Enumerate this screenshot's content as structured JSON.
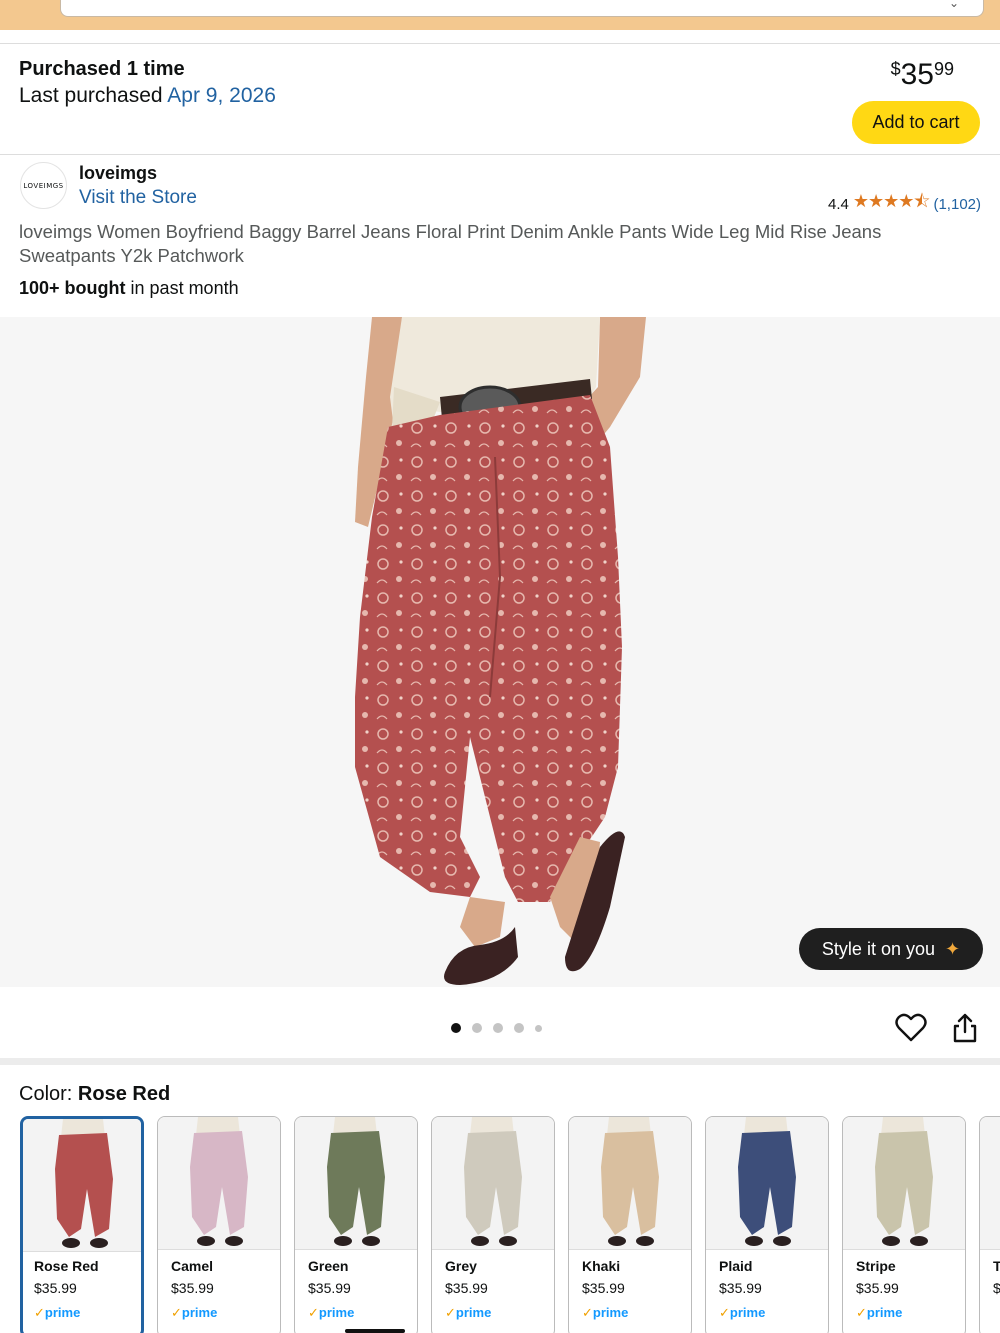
{
  "purchase": {
    "title": "Purchased 1 time",
    "last_prefix": "Last purchased",
    "last_date": "Apr 9, 2026",
    "price_currency": "$",
    "price_dollars": "35",
    "price_cents": "99",
    "add_to_cart_label": "Add to cart"
  },
  "store": {
    "logo_text": "LOVEIMGS",
    "name": "loveimgs",
    "visit_label": "Visit the Store",
    "rating_value": "4.4",
    "rating_stars": 4.4,
    "rating_count": "(1,102)"
  },
  "product": {
    "title": "loveimgs Women Boyfriend Baggy Barrel Jeans Floral Print Denim Ankle Pants Wide Leg Mid Rise Jeans Sweatpants Y2k Patchwork",
    "bought_bold": "100+ bought",
    "bought_rest": "in past month"
  },
  "gallery": {
    "style_button_label": "Style it on you",
    "dots_total": 5,
    "active_dot": 0
  },
  "color": {
    "label": "Color:",
    "selected": "Rose Red",
    "options": [
      {
        "name": "Rose Red",
        "price": "$35.99",
        "prime": "prime",
        "color": "#b4504f"
      },
      {
        "name": "Camel",
        "price": "$35.99",
        "prime": "prime",
        "color": "#d7b7c6"
      },
      {
        "name": "Green",
        "price": "$35.99",
        "prime": "prime",
        "color": "#6e7a5a"
      },
      {
        "name": "Grey",
        "price": "$35.99",
        "prime": "prime",
        "color": "#cfcabd"
      },
      {
        "name": "Khaki",
        "price": "$35.99",
        "prime": "prime",
        "color": "#d9bf9f"
      },
      {
        "name": "Plaid",
        "price": "$35.99",
        "prime": "prime",
        "color": "#3d4e7a"
      },
      {
        "name": "Stripe",
        "price": "$35.99",
        "prime": "prime",
        "color": "#c9c4ab"
      },
      {
        "name": "T",
        "price": "$",
        "prime": "",
        "color": "#ddd"
      }
    ]
  },
  "colors": {
    "accent_link": "#2162a1",
    "cart_button": "#ffd814",
    "star": "#de7921",
    "prime": "#1399ff",
    "selected_border": "#2162a1"
  }
}
